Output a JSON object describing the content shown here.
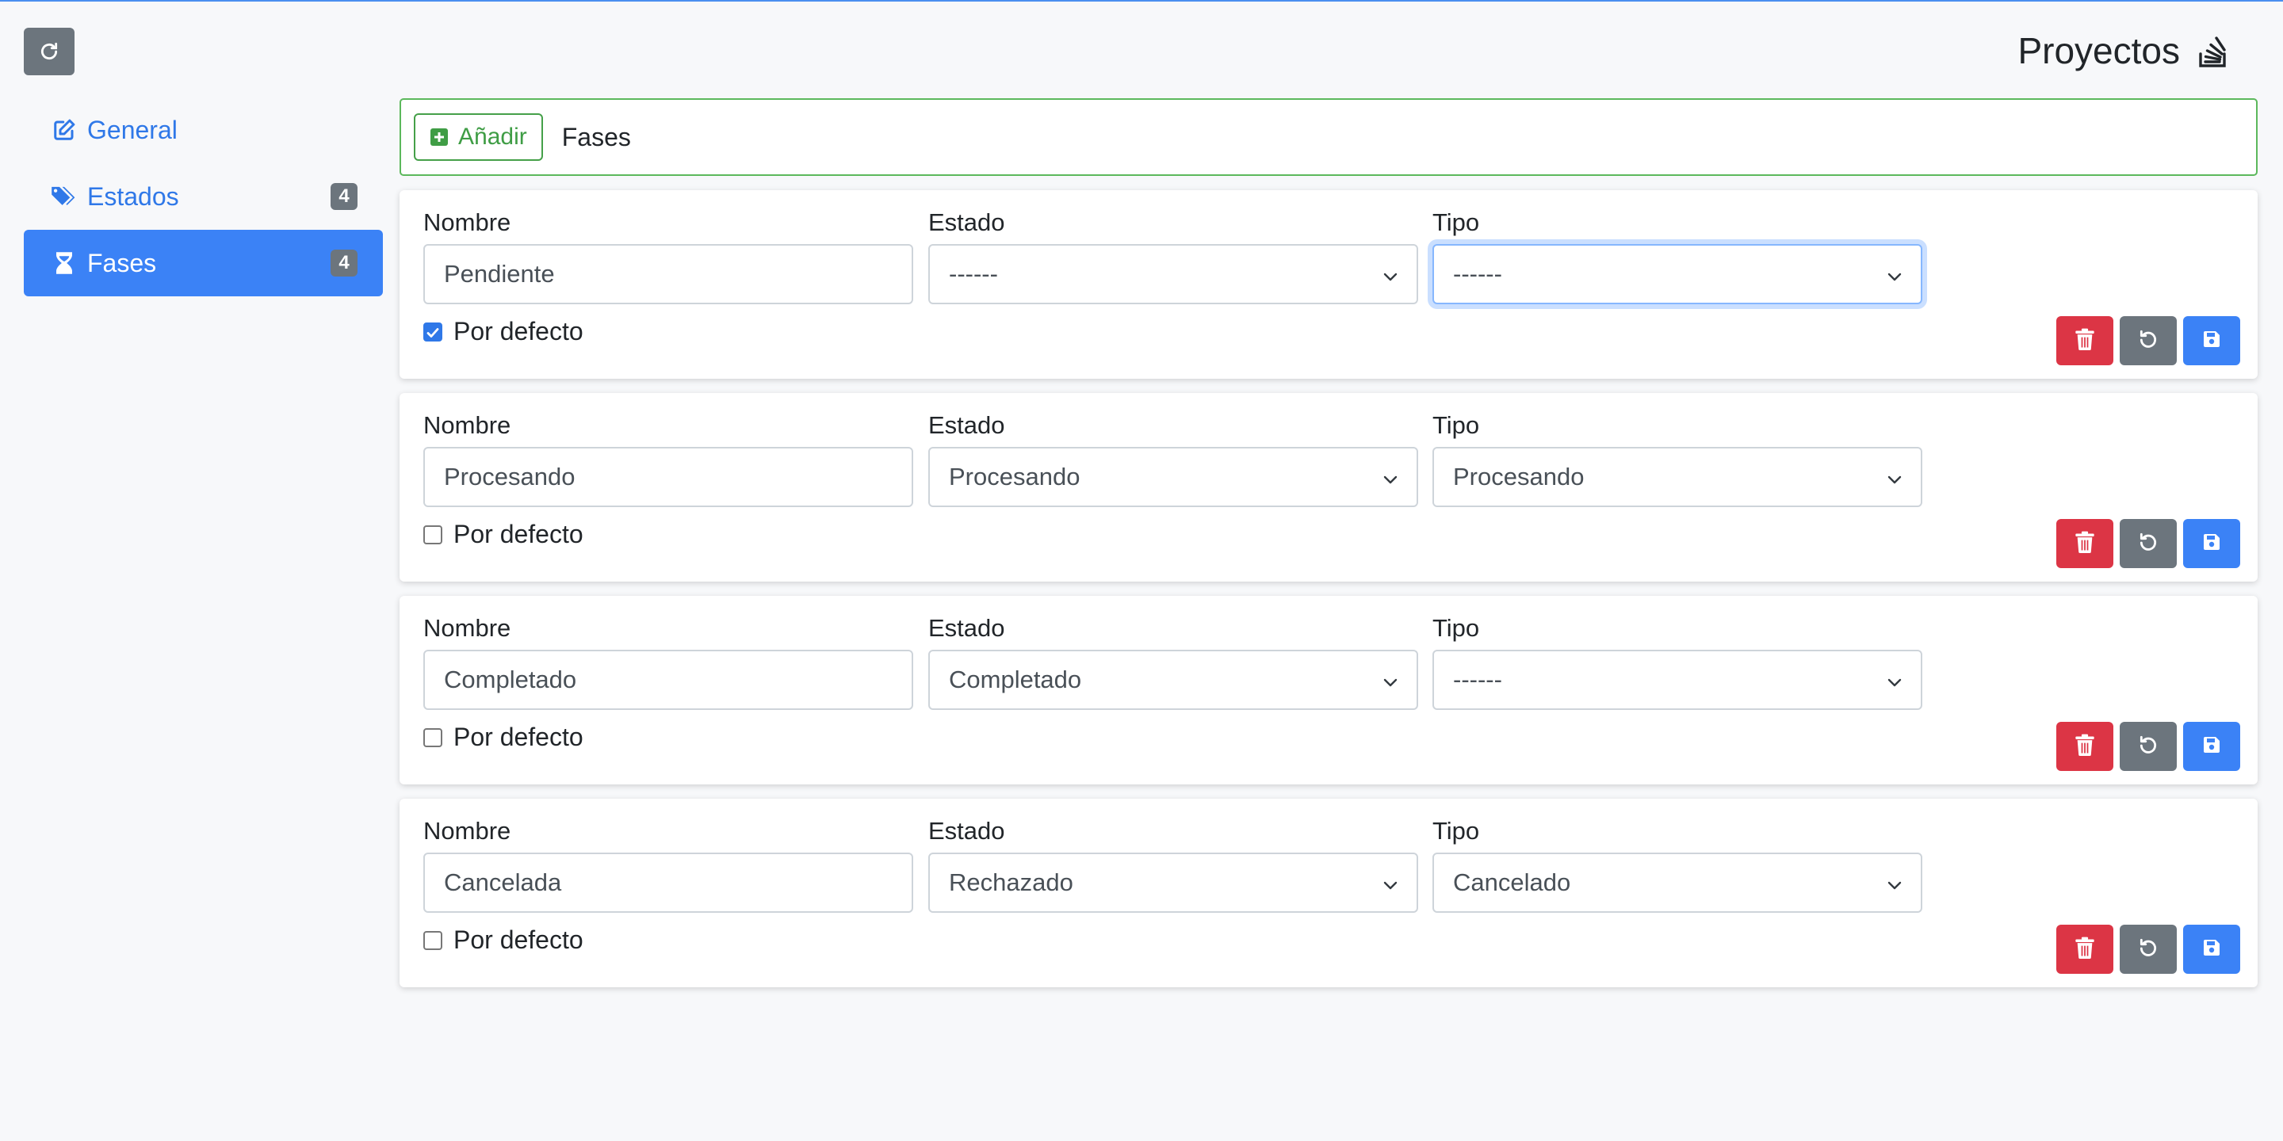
{
  "header": {
    "title": "Proyectos"
  },
  "sidebar": {
    "items": [
      {
        "label": "General",
        "badge": ""
      },
      {
        "label": "Estados",
        "badge": "4"
      },
      {
        "label": "Fases",
        "badge": "4"
      }
    ]
  },
  "toolbar": {
    "add_label": "Añadir",
    "title": "Fases"
  },
  "labels": {
    "nombre": "Nombre",
    "estado": "Estado",
    "tipo": "Tipo",
    "default": "Por defecto"
  },
  "phases": [
    {
      "nombre": "Pendiente",
      "estado": "------",
      "tipo": "------",
      "default": true
    },
    {
      "nombre": "Procesando",
      "estado": "Procesando",
      "tipo": "Procesando",
      "default": false
    },
    {
      "nombre": "Completado",
      "estado": "Completado",
      "tipo": "------",
      "default": false
    },
    {
      "nombre": "Cancelada",
      "estado": "Rechazado",
      "tipo": "Cancelado",
      "default": false
    }
  ],
  "colors": {
    "accent": "#3b82f6",
    "success": "#5cb85c",
    "danger": "#dc3545",
    "secondary": "#6c757d"
  }
}
